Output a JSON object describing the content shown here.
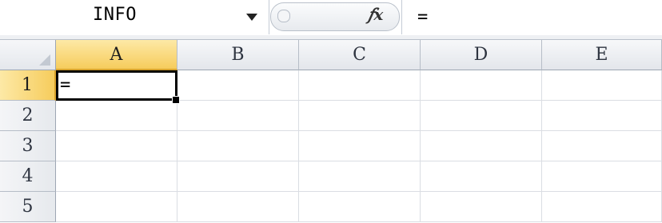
{
  "formula_bar": {
    "name_box": "INFO",
    "fx_icon": "fx-icon",
    "formula": "="
  },
  "grid": {
    "columns": [
      "A",
      "B",
      "C",
      "D",
      "E"
    ],
    "rows": [
      "1",
      "2",
      "3",
      "4",
      "5"
    ],
    "active_column": "A",
    "active_row": "1",
    "cells": [
      [
        "=",
        "",
        "",
        "",
        ""
      ],
      [
        "",
        "",
        "",
        "",
        ""
      ],
      [
        "",
        "",
        "",
        "",
        ""
      ],
      [
        "",
        "",
        "",
        "",
        ""
      ],
      [
        "",
        "",
        "",
        "",
        ""
      ]
    ]
  },
  "colors": {
    "active_header": "#f6cc5c",
    "header_bg": "#e6e9ed",
    "gridline": "#dadde3",
    "selection_border": "#000000"
  }
}
